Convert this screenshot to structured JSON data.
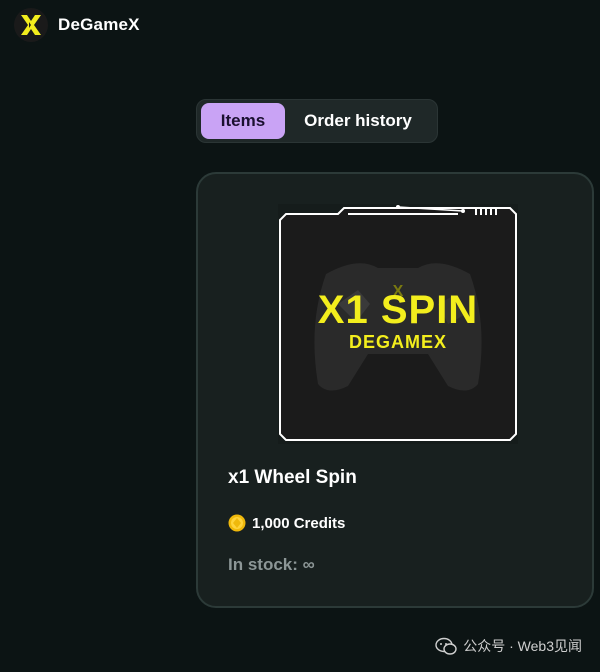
{
  "header": {
    "brand": "DeGameX",
    "logo_icon": "degamex-x-logo-icon"
  },
  "tabs": [
    {
      "label": "Items",
      "active": true
    },
    {
      "label": "Order history",
      "active": false
    }
  ],
  "item": {
    "image_title": "X1 SPIN",
    "image_subtitle": "DEGAMEX",
    "title": "x1 Wheel Spin",
    "price_icon": "credit-coin-icon",
    "price": "1,000 Credits",
    "stock": "In stock: ∞"
  },
  "watermark": {
    "icon": "wechat-icon",
    "text": "公众号 · Web3见闻"
  },
  "colors": {
    "background": "#0c1414",
    "tab_active": "#c9a3f5",
    "card_bg": "#18201f",
    "accent_yellow": "#f3ee1d"
  }
}
